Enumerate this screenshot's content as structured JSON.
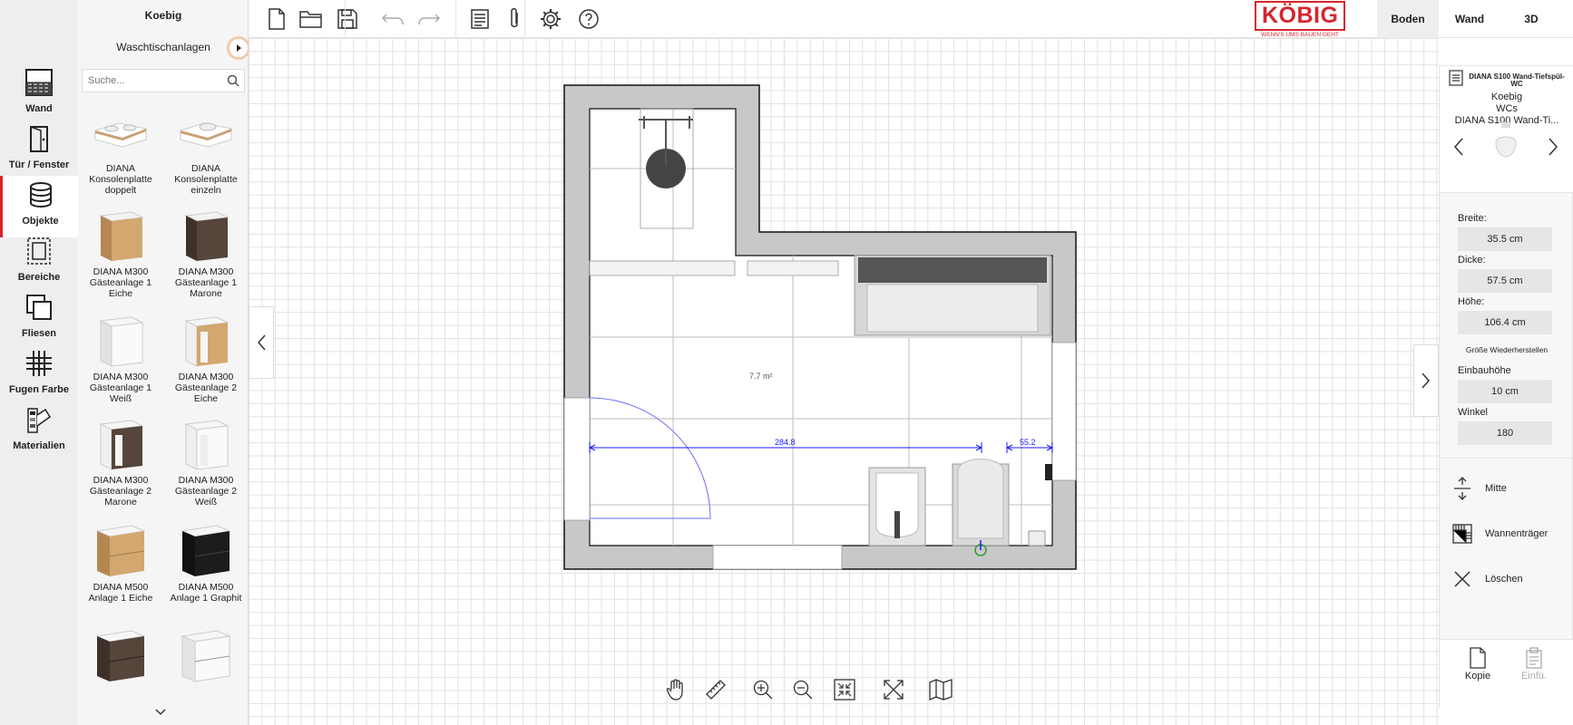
{
  "nav": {
    "items": [
      {
        "label": "Wand",
        "icon": "wall-pattern-icon"
      },
      {
        "label": "Tür / Fenster",
        "icon": "door-icon"
      },
      {
        "label": "Objekte",
        "icon": "database-icon"
      },
      {
        "label": "Bereiche",
        "icon": "area-selection-icon"
      },
      {
        "label": "Fliesen",
        "icon": "tiles-icon"
      },
      {
        "label": "Fugen Farbe",
        "icon": "grout-grid-icon"
      },
      {
        "label": "Materialien",
        "icon": "color-swatch-icon"
      }
    ],
    "active": "Objekte"
  },
  "catalog": {
    "brand": "Koebig",
    "category": "Waschtischanlagen",
    "search_placeholder": "Suche...",
    "products": [
      {
        "name": "DIANA Konsolenplatte doppelt"
      },
      {
        "name": "DIANA Konsolenplatte einzeln"
      },
      {
        "name": "DIANA M300 Gästeanlage 1 Eiche"
      },
      {
        "name": "DIANA M300 Gästeanlage 1 Marone"
      },
      {
        "name": "DIANA M300 Gästeanlage 1 Weiß"
      },
      {
        "name": "DIANA M300 Gästeanlage 2 Eiche"
      },
      {
        "name": "DIANA M300 Gästeanlage 2 Marone"
      },
      {
        "name": "DIANA M300 Gästeanlage 2 Weiß"
      },
      {
        "name": "DIANA M500 Anlage 1 Eiche"
      },
      {
        "name": "DIANA M500 Anlage 1 Graphit"
      },
      {
        "name": ""
      },
      {
        "name": ""
      }
    ]
  },
  "toolbar": {
    "icons": [
      "new-file-icon",
      "open-folder-icon",
      "save-icon",
      "undo-icon",
      "redo-icon",
      "document-list-icon",
      "attachment-icon",
      "settings-gear-icon",
      "help-icon"
    ]
  },
  "logo": {
    "text": "KÖBIG",
    "slogan": "WENN'S UMS BAUEN GEHT",
    "color": "#d4262e"
  },
  "view_tabs": {
    "items": [
      "Boden",
      "Wand",
      "3D"
    ],
    "active": "Boden"
  },
  "plan": {
    "area_label": "7.7 m²",
    "dimension_1": "284.8",
    "dimension_2": "55.2"
  },
  "properties": {
    "title": "DIANA S100 Wand-Tiefspül-WC",
    "manufacturer": "Koebig",
    "category": "WCs",
    "product": "DIANA S100 Wand-Ti...",
    "fields": [
      {
        "label": "Breite:",
        "value": "35.5 cm"
      },
      {
        "label": "Dicke:",
        "value": "57.5 cm"
      },
      {
        "label": "Höhe:",
        "value": "106.4 cm"
      }
    ],
    "reset_size": "Größe Wiederherstellen",
    "fields2": [
      {
        "label": "Einbauhöhe",
        "value": "10 cm"
      },
      {
        "label": "Winkel",
        "value": "180"
      }
    ],
    "actions": [
      "Mitte",
      "Wannenträger",
      "Löschen"
    ],
    "copy": "Kopie",
    "paste": "Einfü."
  },
  "bottom_tools": [
    "pan-hand-icon",
    "ruler-icon",
    "zoom-in-icon",
    "zoom-out-icon",
    "fit-screen-icon",
    "fullscreen-icon",
    "map-icon"
  ],
  "colors": {
    "accent": "#d4262e",
    "wall": "#c8c8c8",
    "dimension": "#1a1aff"
  }
}
